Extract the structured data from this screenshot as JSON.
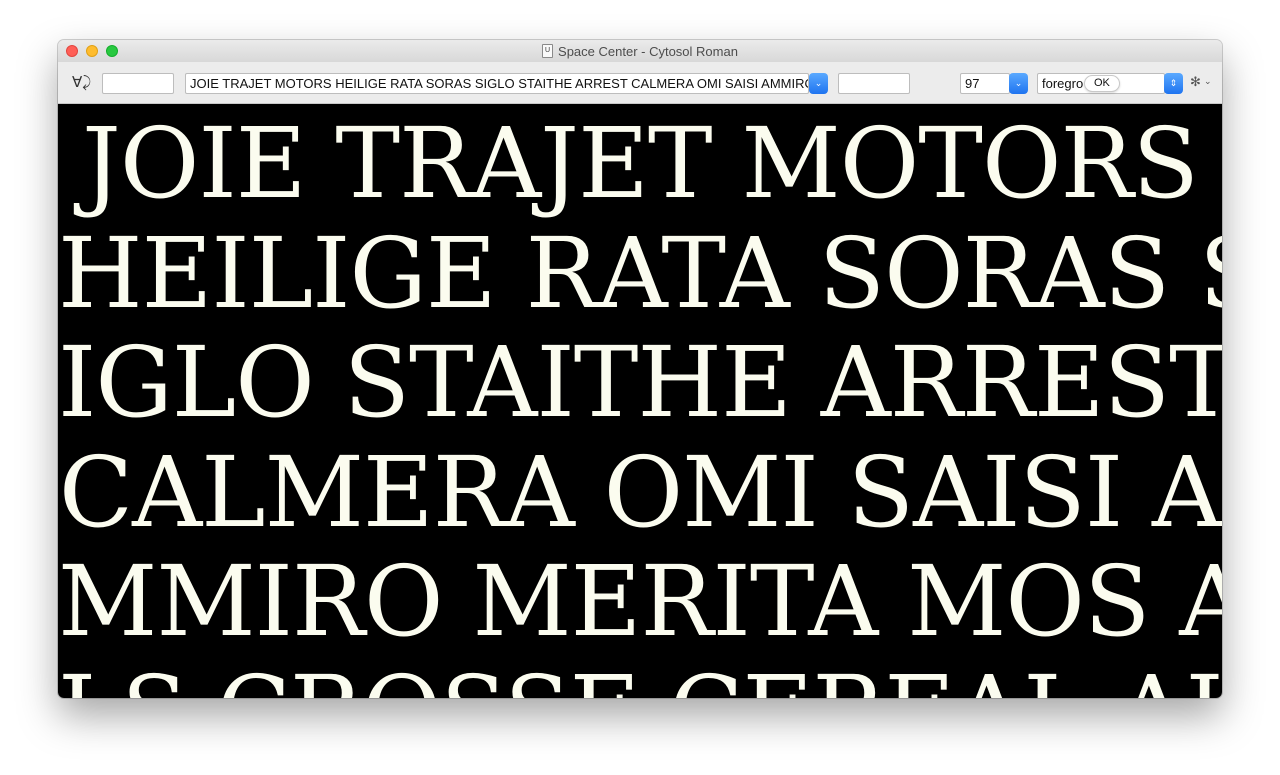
{
  "window": {
    "title": "Space Center - Cytosol Roman",
    "doc_icon": "U"
  },
  "toolbar": {
    "glyph_tool_icon": "∀⤸",
    "left_input_value": "",
    "text_value": "JOIE TRAJET MOTORS HEILIGE RATA SORAS SIGLO STAITHE ARREST CALMERA OMI SAISI AMMIRO",
    "after_input_value": "",
    "size_value": "97",
    "color_value": "foregro",
    "ok_label": "OK",
    "popup_arrow": "⌄",
    "stepper_arrow": "⇕",
    "gear_icon": "✻",
    "gear_caret": "⌄"
  },
  "preview": {
    "lines": [
      "JOIE TRAJET MOTORS",
      "HEILIGE RATA SORAS S",
      "IGLO STAITHE ARREST",
      "CALMERA OMI SAISI A",
      "MMIRO MERITA MOS A",
      "LS CROSSE CEREAL AL"
    ],
    "background": "#000000",
    "text_color": "#fbfcef"
  }
}
